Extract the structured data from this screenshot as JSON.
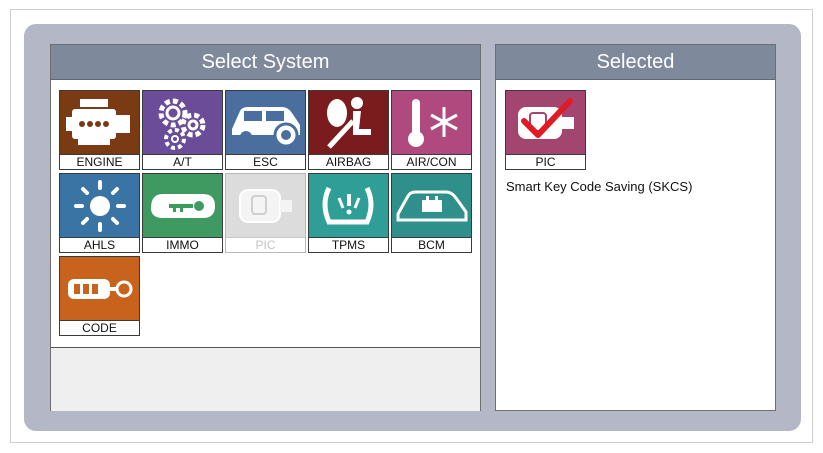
{
  "left_panel": {
    "title": "Select System",
    "tiles": [
      {
        "label": "ENGINE",
        "icon": "engine-icon",
        "color": "#7a3b14",
        "enabled": true
      },
      {
        "label": "A/T",
        "icon": "gears-icon",
        "color": "#6a4c98",
        "enabled": true
      },
      {
        "label": "ESC",
        "icon": "car-brake-icon",
        "color": "#4a6f9f",
        "enabled": true
      },
      {
        "label": "AIRBAG",
        "icon": "airbag-icon",
        "color": "#7a1c1e",
        "enabled": true
      },
      {
        "label": "AIR/CON",
        "icon": "aircon-icon",
        "color": "#b04a7e",
        "enabled": true
      },
      {
        "label": "AHLS",
        "icon": "headlamp-icon",
        "color": "#3a74a5",
        "enabled": true
      },
      {
        "label": "IMMO",
        "icon": "key-icon",
        "color": "#3f9a62",
        "enabled": true
      },
      {
        "label": "PIC",
        "icon": "smart-key-icon",
        "color": "#d9d9d9",
        "enabled": false
      },
      {
        "label": "TPMS",
        "icon": "tire-pressure-icon",
        "color": "#2f9e96",
        "enabled": true
      },
      {
        "label": "BCM",
        "icon": "body-control-icon",
        "color": "#2f8f8a",
        "enabled": true
      },
      {
        "label": "CODE",
        "icon": "code-key-icon",
        "color": "#c8631e",
        "enabled": true
      }
    ]
  },
  "right_panel": {
    "title": "Selected",
    "selected_tile": {
      "label": "PIC",
      "icon": "smart-key-checked-icon",
      "color": "#a3466f"
    },
    "description": "Smart Key Code Saving (SKCS)"
  }
}
